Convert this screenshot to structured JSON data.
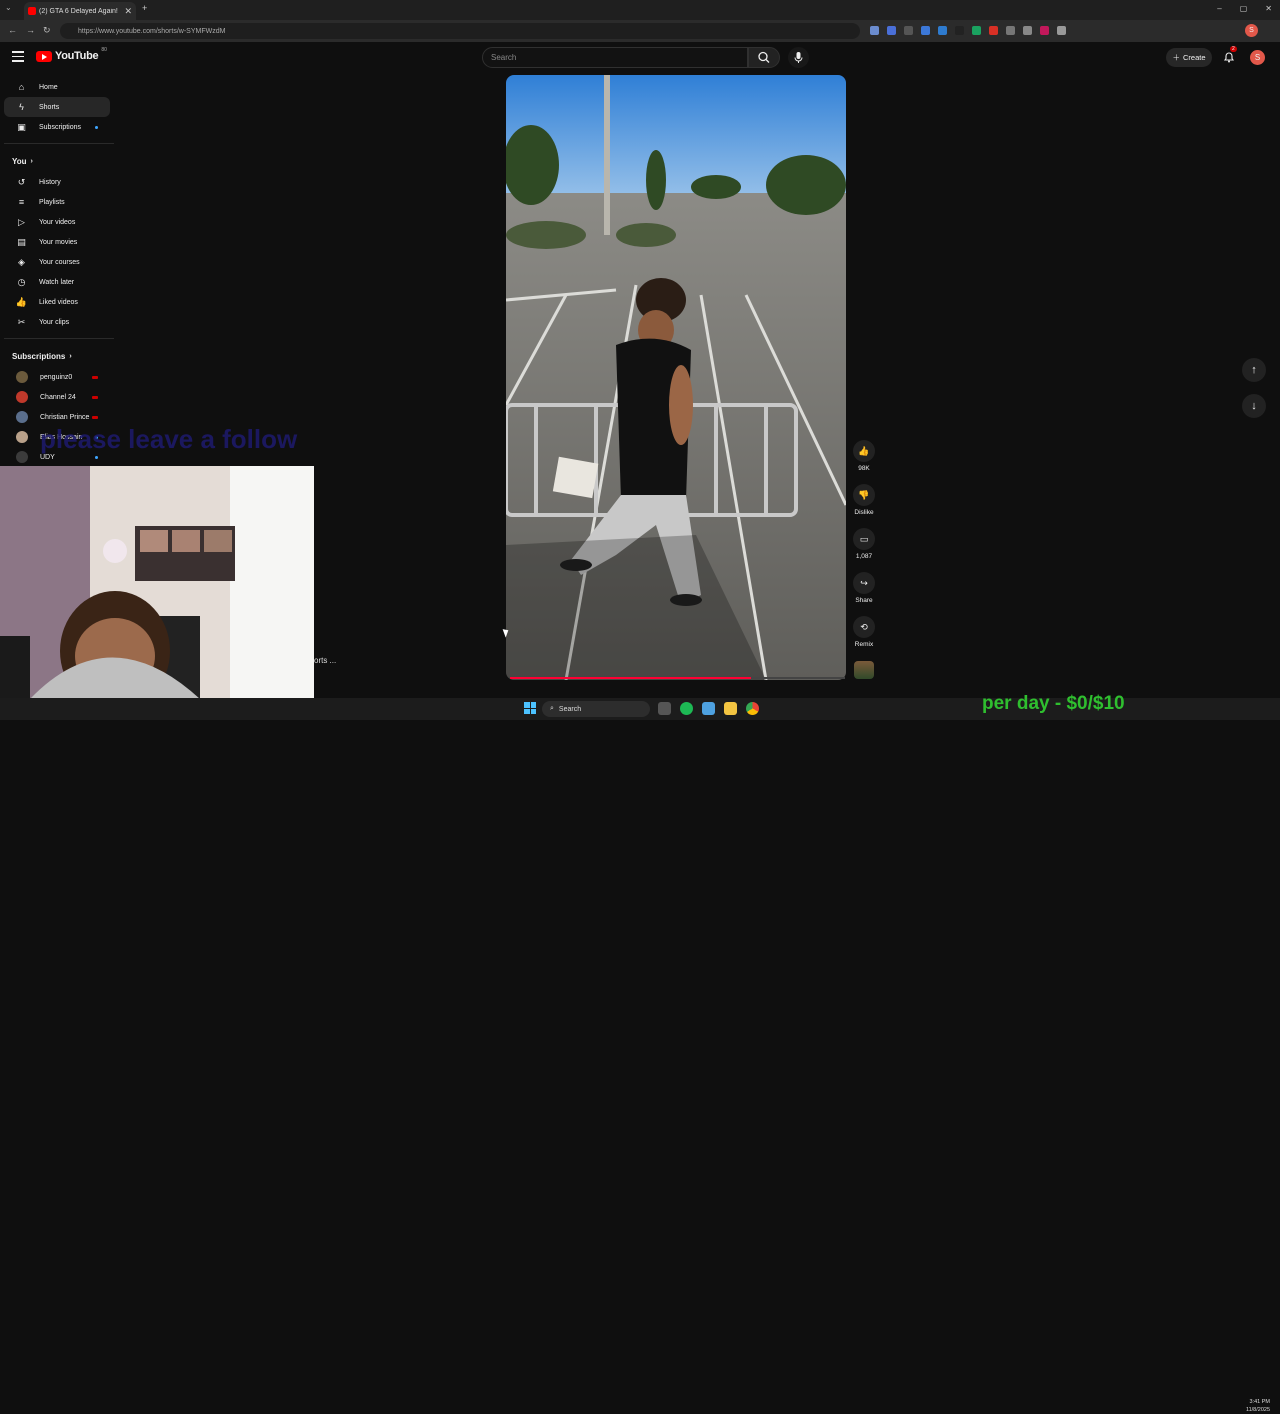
{
  "browser": {
    "tab_title": "(2) GTA 6 Delayed Again!",
    "url": "https://www.youtube.com/shorts/w-SYMFWzdM"
  },
  "header": {
    "logo": "YouTube",
    "logo_cc": "80",
    "search_placeholder": "Search",
    "create_label": "Create",
    "notif_count": "2",
    "avatar_letter": "S"
  },
  "sidebar": {
    "main": [
      {
        "label": "Home",
        "icon": "home-icon"
      },
      {
        "label": "Shorts",
        "icon": "shorts-icon"
      },
      {
        "label": "Subscriptions",
        "icon": "subscriptions-icon"
      }
    ],
    "you_heading": "You",
    "you_items": [
      {
        "label": "History"
      },
      {
        "label": "Playlists"
      },
      {
        "label": "Your videos"
      },
      {
        "label": "Your movies"
      },
      {
        "label": "Your courses"
      },
      {
        "label": "Watch later"
      },
      {
        "label": "Liked videos"
      },
      {
        "label": "Your clips"
      }
    ],
    "subs_heading": "Subscriptions",
    "subs": [
      {
        "label": "penguinz0",
        "color": "#6b5a3c"
      },
      {
        "label": "Channel 24",
        "color": "#c0392b"
      },
      {
        "label": "Christian Prince",
        "color": "#5a6e8c"
      },
      {
        "label": "Elias Hossain",
        "color": "#b9a18a"
      },
      {
        "label": "UDY",
        "color": "#3b3b3b"
      }
    ]
  },
  "actions": {
    "likes": "98K",
    "dislike": "Dislike",
    "comments": "1,087",
    "share": "Share",
    "remix": "Remix"
  },
  "player": {
    "progress": 0.72
  },
  "overlay": {
    "follow_text": "please leave a follow",
    "shorts_label": "orts ...",
    "money_text": "per day - $0/$10"
  },
  "taskbar": {
    "search": "Search",
    "time": "3:41 PM",
    "date": "11/8/2025"
  }
}
